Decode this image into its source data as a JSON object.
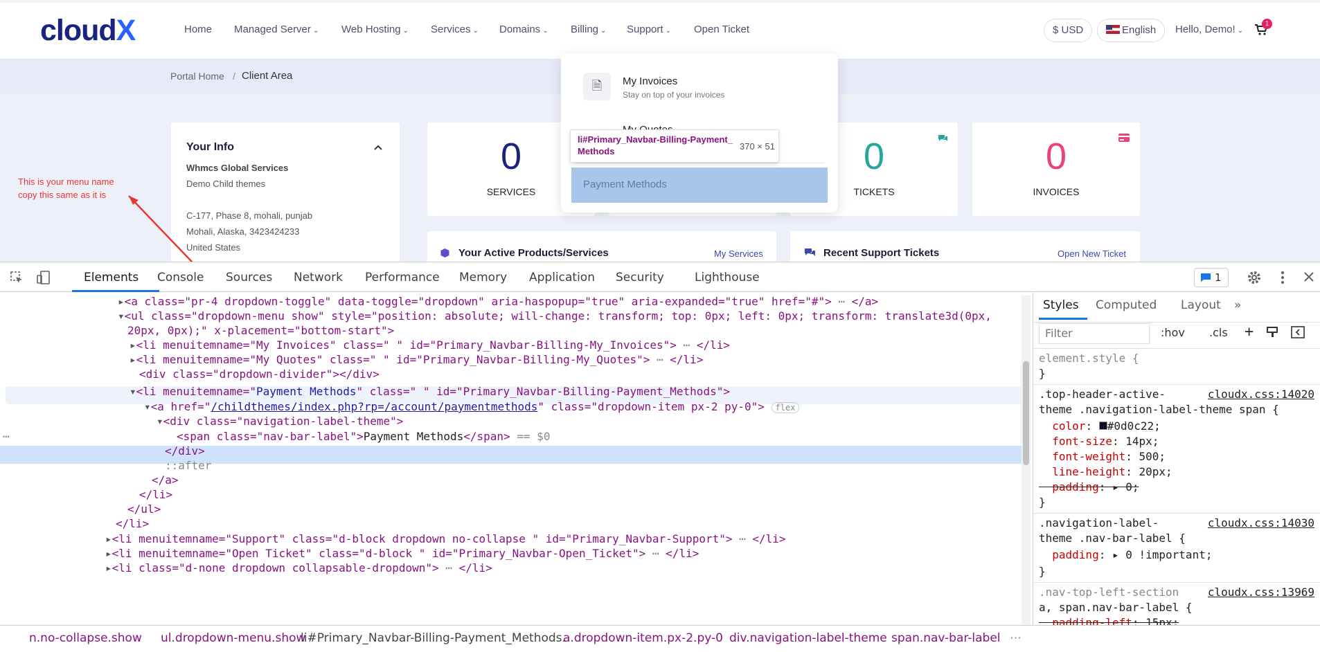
{
  "site": {
    "logo": {
      "main": "cloud",
      "accent": "X"
    },
    "nav": [
      "Home",
      "Managed Server",
      "Web Hosting",
      "Services",
      "Domains",
      "Billing",
      "Support",
      "Open Ticket"
    ],
    "currency": "$ USD",
    "language": "English",
    "greeting": "Hello, Demo!",
    "cart_count": "1",
    "breadcrumb": {
      "home": "Portal Home",
      "sep": "/",
      "current": "Client Area"
    },
    "your_info": {
      "title": "Your Info",
      "company": "Whmcs Global Services",
      "theme": "Demo Child themes",
      "address1": "C-177, Phase 8, mohali, punjab",
      "address2": "Mohali, Alaska, 3423424233",
      "country": "United States"
    },
    "stats": [
      {
        "value": "0",
        "label": "SERVICES",
        "color": "#1a237e"
      },
      {
        "value": "0",
        "label": "TICKETS",
        "color": "#26a69a"
      },
      {
        "value": "0",
        "label": "INVOICES",
        "color": "#ec407a"
      }
    ],
    "billing_menu": {
      "invoices_title": "My Invoices",
      "invoices_sub": "Stay on top of your invoices",
      "quotes_title": "My Quotes",
      "payment_methods": "Payment Methods"
    },
    "tooltip": {
      "selector": "li#Primary_Navbar-Billing-Payment_Methods",
      "size": "370 × 51"
    },
    "panels": {
      "products_title": "Your Active Products/Services",
      "products_link": "My Services",
      "tickets_title": "Recent Support Tickets",
      "tickets_link": "Open New Ticket"
    },
    "annotation": [
      "This is your menu name",
      "copy this same as it is"
    ]
  },
  "devtools": {
    "tabs": [
      "Elements",
      "Console",
      "Sources",
      "Network",
      "Performance",
      "Memory",
      "Application",
      "Security",
      "Lighthouse"
    ],
    "issues_count": "1",
    "code": [
      "<a class=\"pr-4 dropdown-toggle\" data-toggle=\"dropdown\" aria-haspopup=\"true\" aria-expanded=\"true\" href=\"#\">",
      "<ul class=\"dropdown-menu show\" style=\"position: absolute; will-change: transform; top: 0px; left: 0px; transform: translate3d(0px,",
      "20px, 0px);\" x-placement=\"bottom-start\">",
      "<li menuitemname=\"My Invoices\" class=\" \" id=\"Primary_Navbar-Billing-My_Invoices\">",
      "<li menuitemname=\"My Quotes\" class=\" \" id=\"Primary_Navbar-Billing-My_Quotes\">",
      "<div class=\"dropdown-divider\"></div>",
      "<li menuitemname=\"",
      "Payment Methods",
      "\" class=\" \" id=\"Primary_Navbar-Billing-Payment_Methods\">",
      "/childthemes/index.php?rp=/account/paymentmethods",
      "<div class=\"navigation-label-theme\">",
      "Payment Methods",
      "== $0",
      "</div>",
      "::after",
      "</a>",
      "</li>",
      "</ul>",
      "</li>",
      "<li menuitemname=\"Support\" class=\"d-block dropdown no-collapse \" id=\"Primary_Navbar-Support\">",
      "<li menuitemname=\"Open Ticket\" class=\"d-block \" id=\"Primary_Navbar-Open_Ticket\">",
      "<li class=\"d-none dropdown collapsable-dropdown\">"
    ],
    "side_tabs": [
      "Styles",
      "Computed",
      "Layout",
      "»"
    ],
    "filter_placeholder": "Filter",
    "hov": ":hov",
    "cls": ".cls",
    "breadcrumbs": [
      "n.no-collapse.show",
      "ul.dropdown-menu.show",
      "li#Primary_Navbar-Billing-Payment_Methods.",
      "a.dropdown-item.px-2.py-0",
      "div.navigation-label-theme",
      "span.nav-bar-label"
    ]
  }
}
